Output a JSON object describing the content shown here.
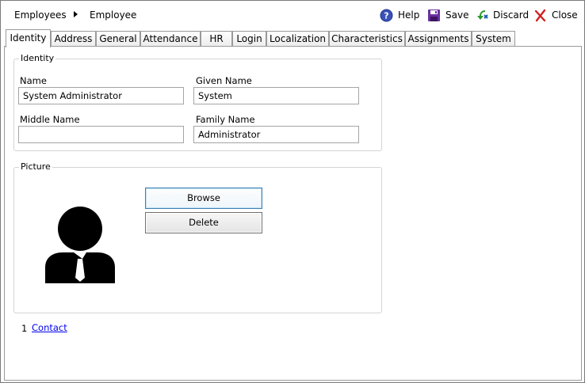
{
  "breadcrumb": {
    "parent": "Employees",
    "current": "Employee"
  },
  "toolbar": {
    "help": "Help",
    "save": "Save",
    "discard": "Discard",
    "close": "Close"
  },
  "tabs": [
    {
      "label": "Identity"
    },
    {
      "label": "Address"
    },
    {
      "label": "General"
    },
    {
      "label": "Attendance"
    },
    {
      "label": "HR"
    },
    {
      "label": "Login"
    },
    {
      "label": "Localization"
    },
    {
      "label": "Characteristics"
    },
    {
      "label": "Assignments"
    },
    {
      "label": "System"
    }
  ],
  "identity": {
    "group_title": "Identity",
    "name_label": "Name",
    "name_value": "System Administrator",
    "given_label": "Given Name",
    "given_value": "System",
    "middle_label": "Middle Name",
    "middle_value": "",
    "family_label": "Family Name",
    "family_value": "Administrator"
  },
  "picture": {
    "group_title": "Picture",
    "browse": "Browse",
    "delete": "Delete"
  },
  "contact": {
    "count": "1",
    "label": "Contact"
  },
  "colors": {
    "help_icon": "#3a52b8",
    "save_icon": "#6a2fa0",
    "discard_icon": "#2a9a2a",
    "close_icon": "#d42020",
    "link": "#0000ee"
  }
}
